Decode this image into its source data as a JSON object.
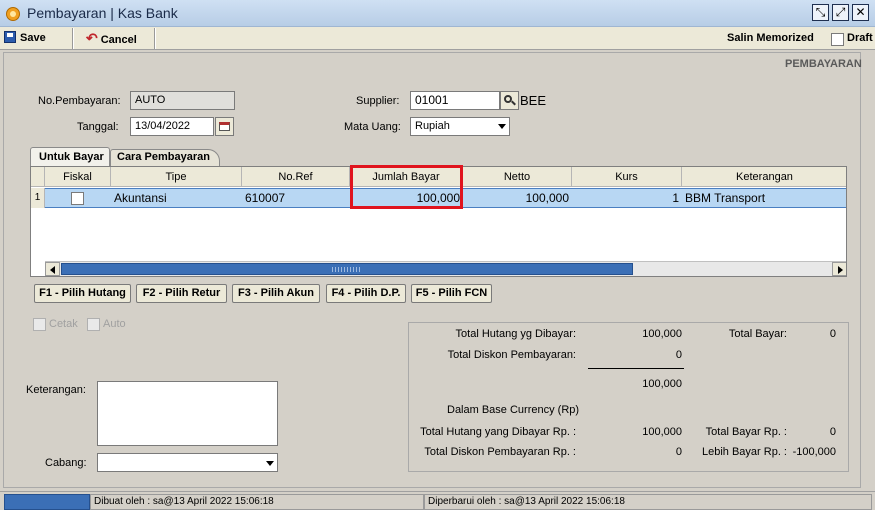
{
  "window": {
    "title": "Pembayaran | Kas Bank",
    "restore": "⤢",
    "maximize": "⤢",
    "close": "✕"
  },
  "toolbar": {
    "save_label": "Save",
    "cancel_label": "Cancel",
    "salin_label": "Salin Memorized",
    "draft_label": "Draft"
  },
  "section_title": "PEMBAYARAN",
  "form": {
    "no_pembayaran_label": "No.Pembayaran:",
    "no_pembayaran_value": "AUTO",
    "tanggal_label": "Tanggal:",
    "tanggal_value": "13/04/2022",
    "supplier_label": "Supplier:",
    "supplier_value": "01001",
    "supplier_name": "BEE",
    "mata_uang_label": "Mata Uang:",
    "mata_uang_value": "Rupiah"
  },
  "tabs": [
    {
      "label": "Untuk Bayar"
    },
    {
      "label": "Cara Pembayaran"
    }
  ],
  "table": {
    "columns": [
      "Fiskal",
      "Tipe",
      "No.Ref",
      "Jumlah Bayar",
      "Netto",
      "Kurs",
      "Keterangan"
    ],
    "rows": [
      {
        "num": "1",
        "tipe": "Akuntansi",
        "no_ref": "610007",
        "jumlah_bayar": "100,000",
        "netto": "100,000",
        "kurs": "1",
        "keterangan": "BBM Transport"
      }
    ]
  },
  "func_buttons": [
    "F1 - Pilih Hutang",
    "F2 - Pilih Retur",
    "F3 - Pilih Akun",
    "F4 - Pilih D.P.",
    "F5 - Pilih FCN"
  ],
  "options": {
    "cetak_label": "Cetak",
    "auto_label": "Auto"
  },
  "keterangan_label": "Keterangan:",
  "cabang_label": "Cabang:",
  "summary": {
    "total_hutang_label": "Total Hutang yg Dibayar:",
    "total_hutang_value": "100,000",
    "total_diskon_label": "Total Diskon Pembayaran:",
    "total_diskon_value": "0",
    "subtotal_value": "100,000",
    "total_bayar_label": "Total Bayar:",
    "total_bayar_value": "0",
    "base_currency_label": "Dalam Base Currency (Rp)",
    "total_hutang_rp_label": "Total Hutang yang Dibayar Rp. :",
    "total_hutang_rp_value": "100,000",
    "total_diskon_rp_label": "Total Diskon Pembayaran Rp. :",
    "total_diskon_rp_value": "0",
    "total_bayar_rp_label": "Total Bayar Rp. :",
    "total_bayar_rp_value": "0",
    "lebih_bayar_rp_label": "Lebih Bayar Rp. :",
    "lebih_bayar_rp_value": "-100,000"
  },
  "status": {
    "dibuat": "Dibuat oleh : sa@13 April 2022  15:06:18",
    "diperbarui": "Diperbarui oleh : sa@13 April 2022  15:06:18"
  },
  "colors": {
    "highlight_box": "#e0141e",
    "selected_row": "#b8d7f3",
    "titlebar": "#c4d8ef"
  }
}
